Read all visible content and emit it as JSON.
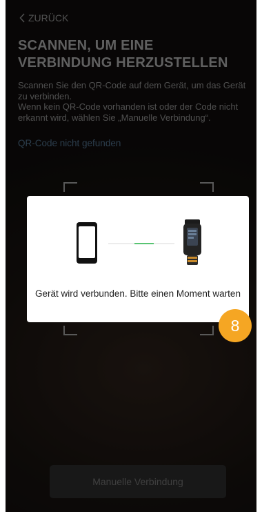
{
  "header": {
    "back_label": "ZURÜCK",
    "title": "SCANNEN, UM EINE VERBINDUNG HERZUSTELLEN",
    "description_line1": "Scannen Sie den QR-Code auf dem Gerät, um das Gerät zu verbinden.",
    "description_line2": "Wenn kein QR-Code vorhanden ist oder der Code nicht erkannt wird, wählen Sie „Manuelle Verbindung“."
  },
  "link": {
    "qr_not_found": "QR-Code nicht gefunden"
  },
  "footer": {
    "manual_button": "Manuelle Verbindung"
  },
  "dialog": {
    "message": "Gerät wird verbunden. Bitte einen Moment warten"
  },
  "badge": {
    "step_number": "8"
  },
  "colors": {
    "badge": "#f5a623",
    "link": "#4d6b86",
    "progress": "#58c472"
  }
}
